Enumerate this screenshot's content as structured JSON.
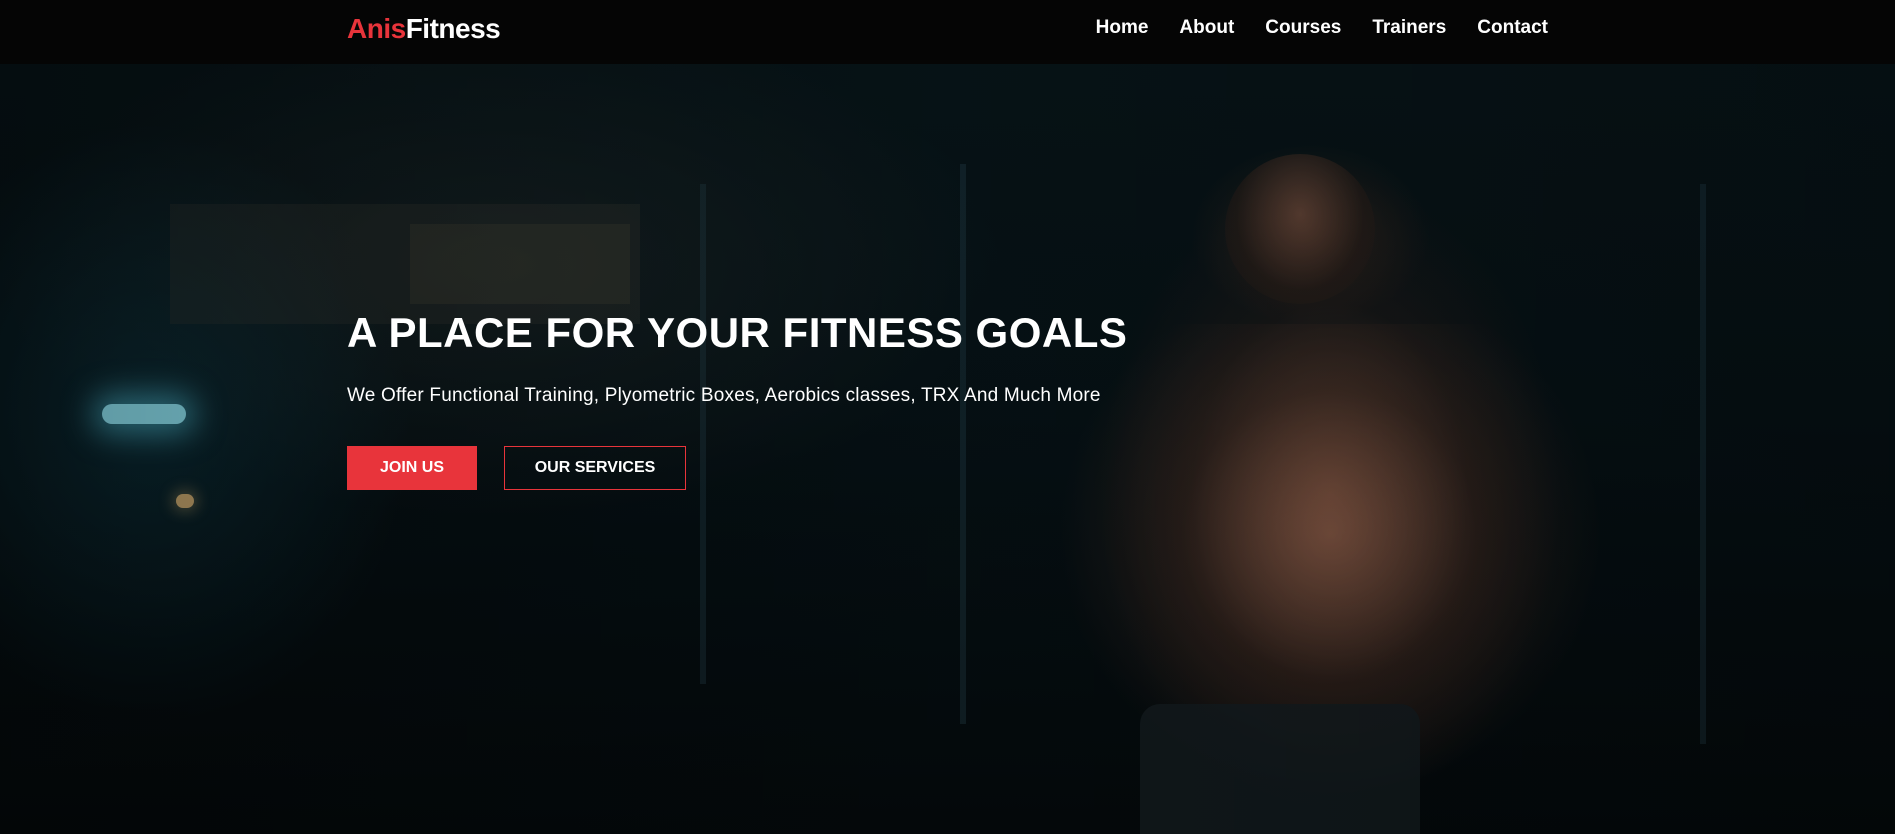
{
  "brand": {
    "accent": "Anis",
    "main": "Fitness",
    "accent_color": "#e8343b"
  },
  "nav": {
    "items": [
      {
        "label": "Home"
      },
      {
        "label": "About"
      },
      {
        "label": "Courses"
      },
      {
        "label": "Trainers"
      },
      {
        "label": "Contact"
      }
    ]
  },
  "hero": {
    "title": "A PLACE FOR YOUR FITNESS GOALS",
    "subtitle": "We Offer Functional Training, Plyometric Boxes, Aerobics classes, TRX And Much More",
    "primary_button": "JOIN US",
    "secondary_button": "OUR SERVICES"
  }
}
